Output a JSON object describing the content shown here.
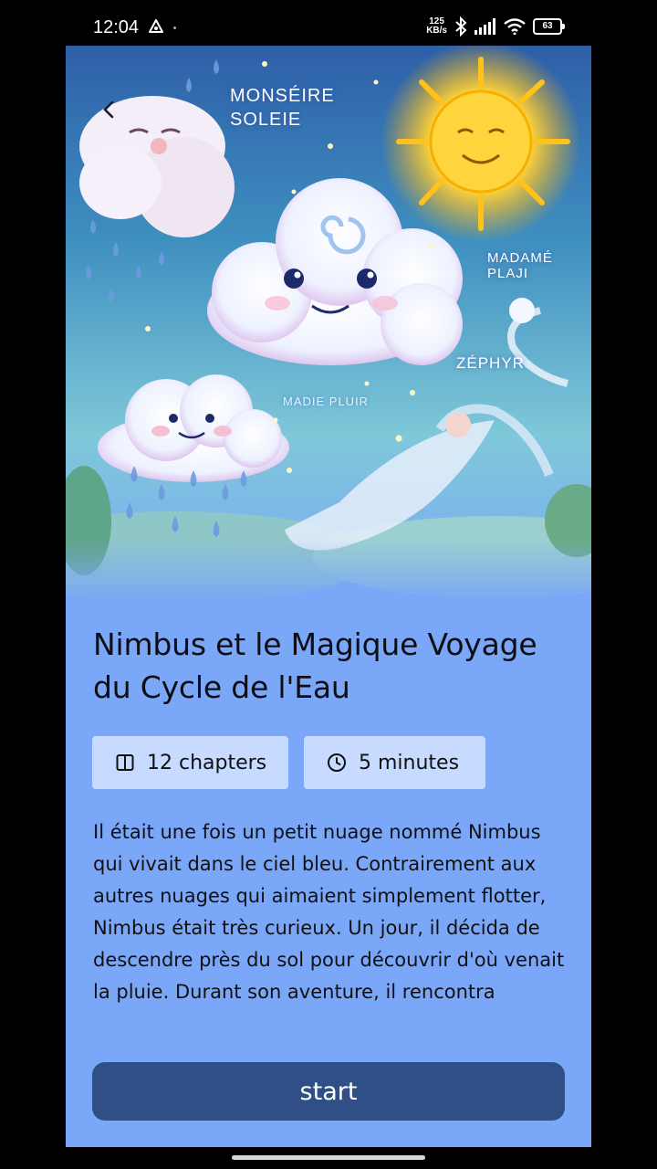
{
  "status_bar": {
    "time": "12:04",
    "speed_value": "125",
    "speed_unit": "KB/s",
    "battery": "63"
  },
  "hero": {
    "labels": {
      "sun": "MONSÉIRE\nSOLEIE",
      "rain": "MADAMÉ PLAJI",
      "wind": "ZÉPHYR",
      "small_cloud": "MADIE PLUIR"
    }
  },
  "story": {
    "title": "Nimbus et le Magique Voyage du Cycle de l'Eau",
    "chapters": "12 chapters",
    "duration": "5 minutes",
    "description": "Il était une fois un petit nuage nommé Nimbus qui vivait dans le ciel bleu. Contrairement aux autres nuages qui aimaient simplement flotter, Nimbus était très curieux. Un jour, il décida de descendre près du sol pour découvrir d'où venait la pluie. Durant son aventure, il rencontra",
    "start_label": "start"
  },
  "colors": {
    "background": "#7aa7f7",
    "chip": "#c6dbff",
    "button": "#2f4f86"
  },
  "icons": {
    "back": "chevron-left-icon",
    "chapters": "book-icon",
    "duration": "clock-icon"
  }
}
